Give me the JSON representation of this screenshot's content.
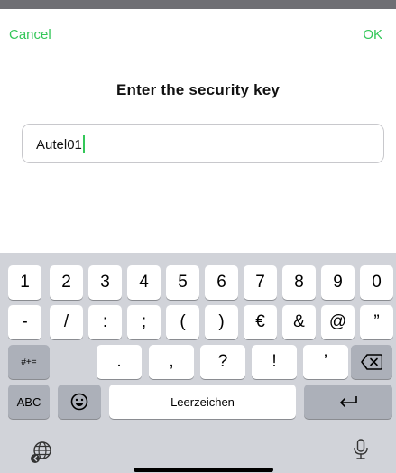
{
  "nav": {
    "cancel_label": "Cancel",
    "ok_label": "OK"
  },
  "dialog": {
    "title": "Enter the security key"
  },
  "input": {
    "value": "Autel01"
  },
  "keyboard": {
    "row1": [
      "1",
      "2",
      "3",
      "4",
      "5",
      "6",
      "7",
      "8",
      "9",
      "0"
    ],
    "row2": [
      "-",
      "/",
      ":",
      ";",
      "(",
      ")",
      "€",
      "&",
      "@",
      "”"
    ],
    "row3": {
      "mode_label": "#+=",
      "keys": [
        ".",
        ",",
        "?",
        "!",
        "’"
      ],
      "delete_icon": "delete-backward-icon"
    },
    "row4": {
      "abc_label": "ABC",
      "emoji_icon": "emoji-icon",
      "space_label": "Leerzeichen",
      "return_icon": "return-icon"
    },
    "bottom": {
      "globe_icon": "globe-icon",
      "mic_icon": "microphone-icon"
    }
  }
}
